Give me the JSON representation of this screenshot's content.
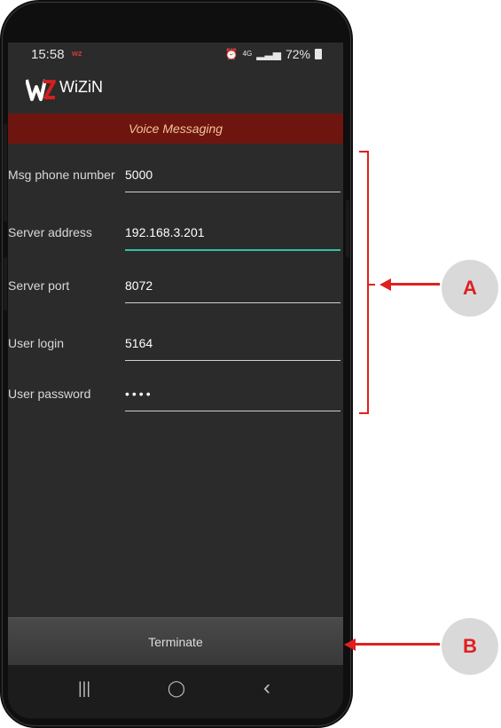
{
  "status_bar": {
    "time": "15:58",
    "app_badge": "wz",
    "network": "4G",
    "battery": "72%"
  },
  "app": {
    "logo_text": "WZ",
    "name": "WiZiN"
  },
  "section": {
    "title": "Voice Messaging"
  },
  "fields": [
    {
      "label": "Msg phone number",
      "value": "5000"
    },
    {
      "label": "Server address",
      "value": "192.168.3.201"
    },
    {
      "label": "Server port",
      "value": "8072"
    },
    {
      "label": "User login",
      "value": "5164"
    },
    {
      "label": "User password",
      "value": "••••"
    }
  ],
  "terminate_label": "Terminate",
  "nav": {
    "recents": "|||",
    "home": "◯",
    "back": "‹"
  },
  "callouts": {
    "a": "A",
    "b": "B"
  },
  "colors": {
    "header_bg": "#6e1510",
    "header_text": "#f0c49a",
    "focus_underline": "#2ec4a3",
    "annotation": "#e02020"
  }
}
